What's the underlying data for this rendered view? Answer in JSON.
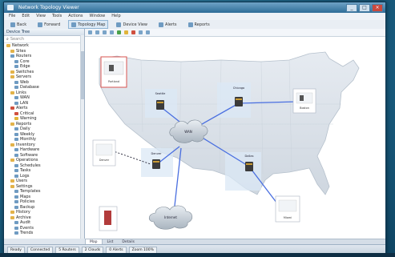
{
  "window": {
    "title": "Network Topology Viewer"
  },
  "titlebar_buttons": [
    "_",
    "□",
    "×"
  ],
  "menu": [
    "File",
    "Edit",
    "View",
    "Tools",
    "Actions",
    "Window",
    "Help"
  ],
  "toolbar": [
    {
      "label": "Back"
    },
    {
      "label": "Forward"
    },
    {
      "label": "Topology Map",
      "selected": true
    },
    {
      "label": "Device View"
    },
    {
      "label": "Alerts"
    },
    {
      "label": "Reports"
    }
  ],
  "sidebar": {
    "header": "Device Tree",
    "search_placeholder": "Search",
    "items": [
      {
        "label": "Network",
        "level": 0,
        "color": "#e3b34a"
      },
      {
        "label": "Sites",
        "level": 1,
        "color": "#e3b34a"
      },
      {
        "label": "Routers",
        "level": 1,
        "color": "#6f9bc2"
      },
      {
        "label": "Core",
        "level": 2,
        "color": "#6f9bc2"
      },
      {
        "label": "Edge",
        "level": 2,
        "color": "#6f9bc2"
      },
      {
        "label": "Switches",
        "level": 1,
        "color": "#e3b34a"
      },
      {
        "label": "Servers",
        "level": 1,
        "color": "#e3b34a"
      },
      {
        "label": "Web",
        "level": 2,
        "color": "#6f9bc2"
      },
      {
        "label": "Database",
        "level": 2,
        "color": "#6f9bc2"
      },
      {
        "label": "Links",
        "level": 1,
        "color": "#e3b34a"
      },
      {
        "label": "WAN",
        "level": 2,
        "color": "#6f9bc2"
      },
      {
        "label": "LAN",
        "level": 2,
        "color": "#6f9bc2"
      },
      {
        "label": "Alerts",
        "level": 1,
        "color": "#d0503f"
      },
      {
        "label": "Critical",
        "level": 2,
        "color": "#d0503f"
      },
      {
        "label": "Warning",
        "level": 2,
        "color": "#e0b43b"
      },
      {
        "label": "Reports",
        "level": 1,
        "color": "#e3b34a"
      },
      {
        "label": "Daily",
        "level": 2,
        "color": "#6f9bc2"
      },
      {
        "label": "Weekly",
        "level": 2,
        "color": "#6f9bc2"
      },
      {
        "label": "Monthly",
        "level": 2,
        "color": "#6f9bc2"
      },
      {
        "label": "Inventory",
        "level": 1,
        "color": "#e3b34a"
      },
      {
        "label": "Hardware",
        "level": 2,
        "color": "#6f9bc2"
      },
      {
        "label": "Software",
        "level": 2,
        "color": "#6f9bc2"
      },
      {
        "label": "Operations",
        "level": 1,
        "color": "#e3b34a"
      },
      {
        "label": "Schedules",
        "level": 2,
        "color": "#6f9bc2"
      },
      {
        "label": "Tasks",
        "level": 2,
        "color": "#6f9bc2"
      },
      {
        "label": "Logs",
        "level": 2,
        "color": "#6f9bc2"
      },
      {
        "label": "Users",
        "level": 1,
        "color": "#e3b34a"
      },
      {
        "label": "Settings",
        "level": 1,
        "color": "#e3b34a"
      },
      {
        "label": "Templates",
        "level": 2,
        "color": "#6f9bc2"
      },
      {
        "label": "Maps",
        "level": 2,
        "color": "#6f9bc2"
      },
      {
        "label": "Policies",
        "level": 2,
        "color": "#6f9bc2"
      },
      {
        "label": "Backup",
        "level": 2,
        "color": "#6f9bc2"
      },
      {
        "label": "History",
        "level": 1,
        "color": "#e3b34a"
      },
      {
        "label": "Archive",
        "level": 1,
        "color": "#e3b34a"
      },
      {
        "label": "Audit",
        "level": 2,
        "color": "#6f9bc2"
      },
      {
        "label": "Events",
        "level": 2,
        "color": "#6f9bc2"
      },
      {
        "label": "Trends",
        "level": 2,
        "color": "#6f9bc2"
      }
    ]
  },
  "map": {
    "clouds": [
      {
        "label": "WAN"
      },
      {
        "label": "Internet"
      }
    ],
    "routers": [
      {
        "label": "Seattle"
      },
      {
        "label": "Denver"
      },
      {
        "label": "Chicago"
      },
      {
        "label": "Dallas"
      },
      {
        "label": "Boston"
      }
    ],
    "site_labels": [
      "Seattle",
      "Denver",
      "Chicago",
      "Dallas",
      "Boston",
      "Miami",
      "Portland"
    ]
  },
  "doc_tabs": [
    {
      "label": "Map",
      "active": true
    },
    {
      "label": "List"
    },
    {
      "label": "Details"
    }
  ],
  "status": [
    "Ready",
    "Connected",
    "5 Routers",
    "2 Clouds",
    "0 Alerts",
    "Zoom 100%"
  ]
}
